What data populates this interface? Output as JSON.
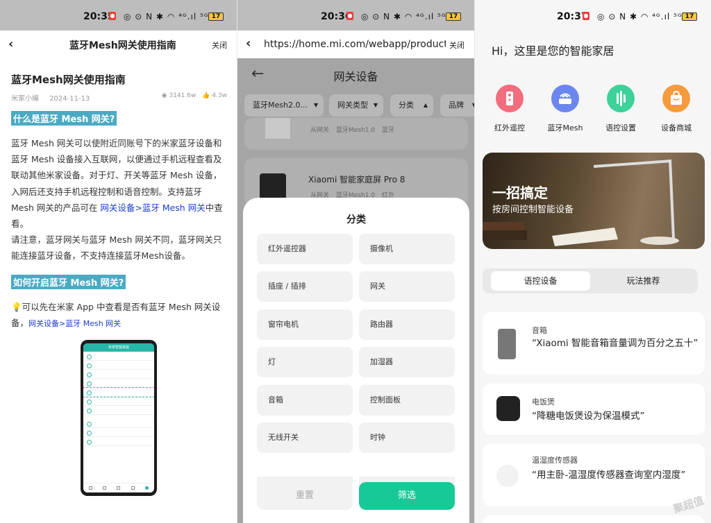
{
  "status_bars": [
    {
      "time": "20:35",
      "battery": "17",
      "icons": "◎ ⊙ N ✱ ◠ ⁴ᴳ.ıl ⁵ᴳ.ıl"
    },
    {
      "time": "20:36",
      "battery": "17",
      "icons": "◎ ⊙ N ✱ ◠ ⁴ᴳ.ıl ⁵ᴳ.ıl"
    },
    {
      "time": "20:37",
      "battery": "17",
      "icons": "◎ ⊙ N ✱ ◠ ⁴ᴳ.ıl ⁵ᴳ.ıl"
    }
  ],
  "article": {
    "nav_title": "蓝牙Mesh网关使用指南",
    "close": "关闭",
    "heading": "蓝牙Mesh网关使用指南",
    "author": "米家小编",
    "date": "2024-11-13",
    "views": "3141.6w",
    "likes": "4.3w",
    "q1": "什么是蓝牙 Mesh 网关?",
    "p1": "蓝牙 Mesh 网关可以使附近同账号下的米家蓝牙设备和蓝牙 Mesh 设备接入互联网，以便通过手机远程查看及联动其他米家设备。对于灯、开关等蓝牙 Mesh 设备，入网后还支持手机远程控制和语音控制。支持蓝牙 Mesh 网关的产品可在",
    "p1_link": "网关设备>蓝牙 Mesh 网关",
    "p1_end": "中查看。",
    "p2": "请注意，蓝牙网关与蓝牙 Mesh 网关不同，蓝牙网关只能连接蓝牙设备，不支持连接蓝牙Mesh设备。",
    "q2": "如何开启蓝牙 Mesh 网关?",
    "p3_icon": "💡",
    "p3": "可以先在米家 App 中查看是否有蓝牙 Mesh 网关设备，",
    "p3_link": "网关设备>蓝牙 Mesh 网关",
    "phone_header": "米家智能家庭"
  },
  "gateway": {
    "url": "https://home.mi.com/webapp/product/g...",
    "close": "关闭",
    "title": "网关设备",
    "filters": [
      "蓝牙Mesh2.0...",
      "网关类型",
      "分类",
      "品牌"
    ],
    "card1_tags": [
      "从网关",
      "蓝牙Mesh1.0",
      "蓝牙"
    ],
    "card2_name": "Xiaomi 智能家庭屏 Pro 8",
    "card2_tags": [
      "从网关",
      "蓝牙Mesh1.0",
      "红外"
    ],
    "sheet_title": "分类",
    "categories": [
      "红外遥控器",
      "摄像机",
      "插座 / 插排",
      "网关",
      "窗帘电机",
      "路由器",
      "灯",
      "加湿器",
      "音箱",
      "控制面板",
      "无线开关",
      "时钟"
    ],
    "reset": "重置",
    "apply": "筛选"
  },
  "home": {
    "greeting": "Hi，这里是您的智能家居",
    "quick": [
      {
        "label": "红外遥控",
        "color": "#f26d7d"
      },
      {
        "label": "蓝牙Mesh",
        "color": "#6c86f0"
      },
      {
        "label": "语控设置",
        "color": "#3ed199"
      },
      {
        "label": "设备商城",
        "color": "#f59a3d"
      }
    ],
    "banner_title": "一招搞定",
    "banner_sub": "按房间控制智能设备",
    "tab_on": "语控设备",
    "tab_off": "玩法推荐",
    "devices": [
      {
        "category": "音箱",
        "command": "“Xiaomi 智能音箱音量调为百分之五十”"
      },
      {
        "category": "电饭煲",
        "command": "“降糖电饭煲设为保温模式”"
      },
      {
        "category": "温湿度传感器",
        "command": "“用主卧-温湿度传感器查询室内湿度”"
      }
    ],
    "watermark": "聚超值"
  }
}
